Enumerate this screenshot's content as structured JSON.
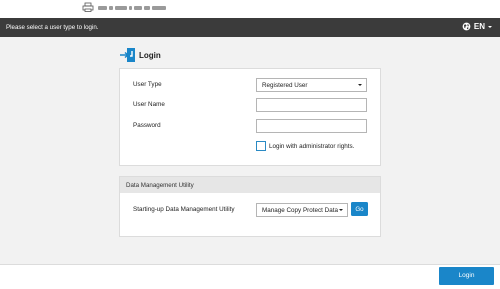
{
  "header": {
    "message": "Please select a user type to login.",
    "language": "EN",
    "icons": [
      "printer-icon",
      "globe-icon",
      "chevron-down-icon"
    ]
  },
  "login": {
    "title": "Login",
    "user_type_label": "User Type",
    "user_type_value": "Registered User",
    "user_name_label": "User Name",
    "user_name_value": "",
    "password_label": "Password",
    "password_value": "",
    "admin_checkbox_label": "Login with administrator rights.",
    "admin_checkbox_checked": false
  },
  "data_management": {
    "title": "Data Management Utility",
    "startup_label": "Starting-up Data Management Utility",
    "startup_value": "Manage Copy Protect Data",
    "go_label": "Go"
  },
  "footer": {
    "login_button": "Login"
  },
  "colors": {
    "header_bg": "#3b3b3b",
    "accent": "#1a86c9",
    "page_bg": "#f2f2f2"
  }
}
